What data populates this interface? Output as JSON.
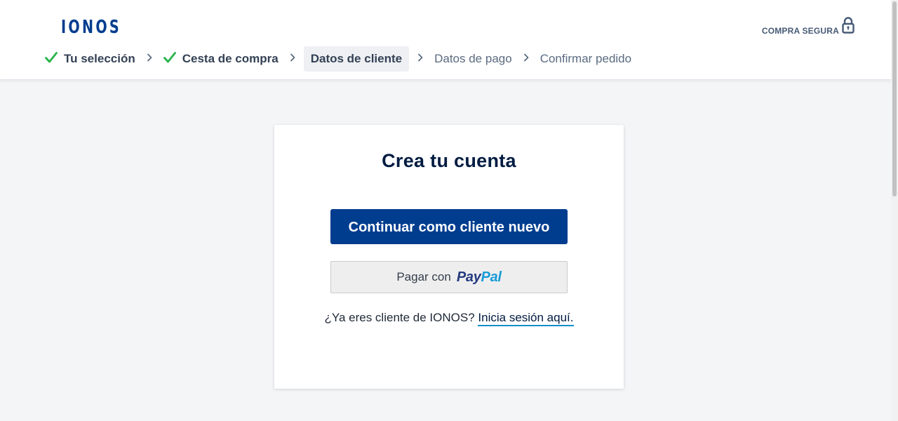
{
  "brand": {
    "logo_text": "IONOS",
    "color": "#003d8f"
  },
  "header": {
    "secure_label": "COMPRA SEGURA",
    "secure_icon": "lock-icon"
  },
  "steps": [
    {
      "label": "Tu selección",
      "state": "done"
    },
    {
      "label": "Cesta de compra",
      "state": "done"
    },
    {
      "label": "Datos de cliente",
      "state": "current"
    },
    {
      "label": "Datos de pago",
      "state": "todo"
    },
    {
      "label": "Confirmar pedido",
      "state": "todo"
    }
  ],
  "card": {
    "title": "Crea tu cuenta",
    "primary_button": "Continuar como cliente nuevo",
    "paypal_prefix": "Pagar con",
    "paypal_logo_part1": "Pay",
    "paypal_logo_part2": "Pal",
    "login_prompt": "¿Ya eres cliente de IONOS?",
    "login_link": "Inicia sesión aquí."
  },
  "colors": {
    "primary": "#003d8f",
    "check": "#27b34b",
    "link_underline": "#0b8ecb",
    "background": "#f4f5f7"
  }
}
